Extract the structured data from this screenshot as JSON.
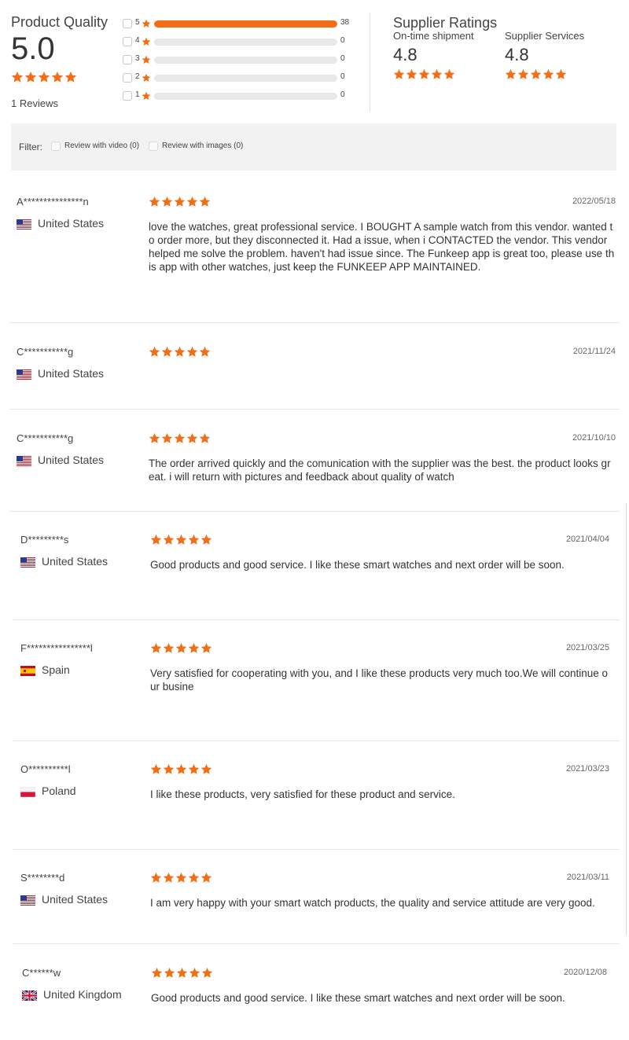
{
  "colors": {
    "accent": "#f26d14",
    "track": "#e8e8e8",
    "filter_bg": "#f2f2f2"
  },
  "product_quality": {
    "title": "Product Quality",
    "score": "5.0",
    "star_rating": 5,
    "reviews_label": "1 Reviews"
  },
  "distribution": [
    {
      "level": "5",
      "count": "38",
      "fraction": 1.0
    },
    {
      "level": "4",
      "count": "0",
      "fraction": 0
    },
    {
      "level": "3",
      "count": "0",
      "fraction": 0
    },
    {
      "level": "2",
      "count": "0",
      "fraction": 0
    },
    {
      "level": "1",
      "count": "0",
      "fraction": 0
    }
  ],
  "supplier_ratings": {
    "title": "Supplier Ratings",
    "items": [
      {
        "label": "On-time shipment",
        "value": "4.8",
        "star_rating": 5
      },
      {
        "label": "Supplier Services",
        "value": "4.8",
        "star_rating": 5
      }
    ]
  },
  "filter": {
    "label": "Filter:",
    "options": [
      "Review with video (0)",
      "Review with images (0)"
    ]
  },
  "reviews": [
    {
      "name": "A***************n",
      "country": "United States",
      "flag": "us",
      "stars": 5,
      "date": "2022/05/18",
      "text": "love the watches, great professional service. I BOUGHT A sample watch from this vendor. wanted to order more, but they disconnected it. Had a issue, when i CONTACTED the vendor. This vendor helped me solve the problem. haven't had issue since. The Funkeep app is great too, please use this app with other watches, just keep the FUNKEEP APP MAINTAINED."
    },
    {
      "name": "C***********g",
      "country": "United States",
      "flag": "us",
      "stars": 5,
      "date": "2021/11/24",
      "text": ""
    },
    {
      "name": "C***********g",
      "country": "United States",
      "flag": "us",
      "stars": 5,
      "date": "2021/10/10",
      "text": "The order arrived quickly and the comunication with the supplier was the best. the product looks great. i will return with pictures and feedback about quality of watch"
    },
    {
      "name": "D*********s",
      "country": "United States",
      "flag": "us",
      "stars": 5,
      "date": "2021/04/04",
      "text": "Good products and good service. I like these smart watches and next order will be soon."
    },
    {
      "name": "F****************l",
      "country": "Spain",
      "flag": "es",
      "stars": 5,
      "date": "2021/03/25",
      "text": "Very satisfied for cooperating with you, and I like these products very much too.We will continue our busine"
    },
    {
      "name": "O**********l",
      "country": "Poland",
      "flag": "pl",
      "stars": 5,
      "date": "2021/03/23",
      "text": "I like these products, very satisfied for these product and service."
    },
    {
      "name": "S********d",
      "country": "United States",
      "flag": "us",
      "stars": 5,
      "date": "2021/03/11",
      "text": "I am very happy with your smart watch products, the quality and service attitude are very good."
    },
    {
      "name": "C******w",
      "country": "United Kingdom",
      "flag": "gb",
      "stars": 5,
      "date": "2020/12/08",
      "text": "Good products and good service. I like these smart watches and next order will be soon."
    }
  ]
}
